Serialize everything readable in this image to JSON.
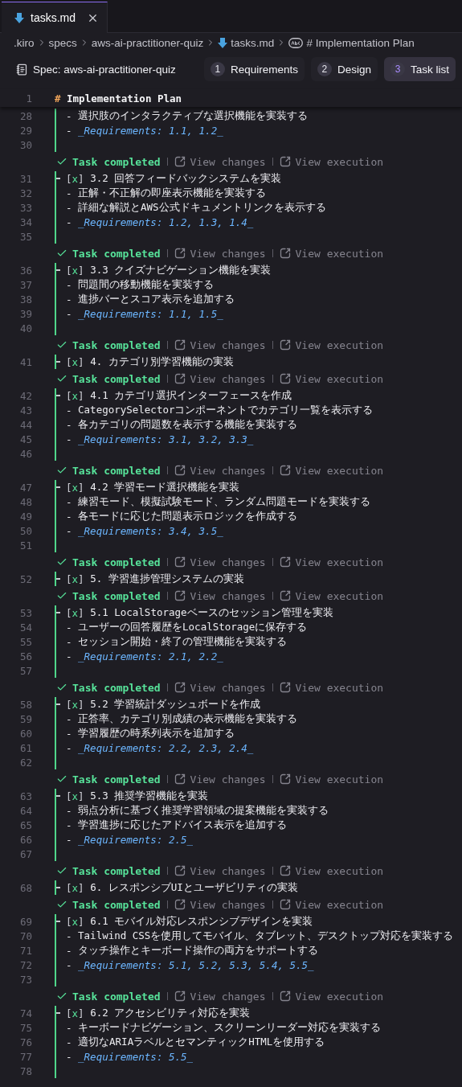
{
  "tab": {
    "label": "tasks.md",
    "selected": true
  },
  "breadcrumb": [
    {
      "label": ".kiro",
      "kind": "folder"
    },
    {
      "label": "specs",
      "kind": "folder"
    },
    {
      "label": "aws-ai-practitioner-quiz",
      "kind": "folder"
    },
    {
      "label": "tasks.md",
      "kind": "file"
    },
    {
      "label": "# Implementation Plan",
      "kind": "symbol"
    }
  ],
  "spec": {
    "title": "Spec: aws-ai-practitioner-quiz",
    "steps": [
      {
        "num": "1",
        "label": "Requirements",
        "selected": false
      },
      {
        "num": "2",
        "label": "Design",
        "selected": false
      },
      {
        "num": "3",
        "label": "Task list",
        "selected": true
      }
    ]
  },
  "sticky": {
    "n": "1",
    "hash": "#",
    "text": "Implementation Plan"
  },
  "groups": [
    {
      "lines": [
        {
          "n": "28",
          "kind": "bullet",
          "bullet": "-",
          "text": "選択肢のインタラクティブな選択機能を実装する"
        },
        {
          "n": "29",
          "kind": "requirement",
          "bullet": "-",
          "text": "_Requirements: 1.1, 1.2_"
        },
        {
          "n": "30",
          "kind": "blank"
        }
      ]
    },
    {
      "lens": {
        "status": "Task completed",
        "actions": [
          "View changes",
          "View execution"
        ]
      },
      "lines": [
        {
          "n": "31",
          "kind": "task",
          "box": "[x]",
          "checked": true,
          "text": "3.2 回答フィードバックシステムを実装"
        },
        {
          "n": "32",
          "kind": "bullet",
          "bullet": "-",
          "text": "正解・不正解の即座表示機能を実装する"
        },
        {
          "n": "33",
          "kind": "bullet",
          "bullet": "-",
          "text": "詳細な解説とAWS公式ドキュメントリンクを表示する"
        },
        {
          "n": "34",
          "kind": "requirement",
          "bullet": "-",
          "text": "_Requirements: 1.2, 1.3, 1.4_"
        },
        {
          "n": "35",
          "kind": "blank"
        }
      ]
    },
    {
      "lens": {
        "status": "Task completed",
        "actions": [
          "View changes",
          "View execution"
        ]
      },
      "lines": [
        {
          "n": "36",
          "kind": "task",
          "box": "[x]",
          "checked": true,
          "text": "3.3 クイズナビゲーション機能を実装"
        },
        {
          "n": "37",
          "kind": "bullet",
          "bullet": "-",
          "text": "問題間の移動機能を実装する"
        },
        {
          "n": "38",
          "kind": "bullet",
          "bullet": "-",
          "text": "進捗バーとスコア表示を追加する"
        },
        {
          "n": "39",
          "kind": "requirement",
          "bullet": "-",
          "text": "_Requirements: 1.1, 1.5_"
        },
        {
          "n": "40",
          "kind": "blank"
        }
      ]
    },
    {
      "lens": {
        "status": "Task completed",
        "actions": [
          "View changes",
          "View execution"
        ]
      },
      "lines": [
        {
          "n": "41",
          "kind": "task",
          "box": "[x]",
          "checked": true,
          "text": "4. カテゴリ別学習機能の実装"
        }
      ]
    },
    {
      "lens": {
        "status": "Task completed",
        "actions": [
          "View changes",
          "View execution"
        ]
      },
      "lines": [
        {
          "n": "42",
          "kind": "task",
          "box": "[x]",
          "checked": true,
          "text": "4.1 カテゴリ選択インターフェースを作成"
        },
        {
          "n": "43",
          "kind": "bullet",
          "bullet": "-",
          "text": "CategorySelectorコンポーネントでカテゴリ一覧を表示する"
        },
        {
          "n": "44",
          "kind": "bullet",
          "bullet": "-",
          "text": "各カテゴリの問題数を表示する機能を実装する"
        },
        {
          "n": "45",
          "kind": "requirement",
          "bullet": "-",
          "text": "_Requirements: 3.1, 3.2, 3.3_"
        },
        {
          "n": "46",
          "kind": "blank"
        }
      ]
    },
    {
      "lens": {
        "status": "Task completed",
        "actions": [
          "View changes",
          "View execution"
        ]
      },
      "lines": [
        {
          "n": "47",
          "kind": "task",
          "box": "[x]",
          "checked": true,
          "text": "4.2 学習モード選択機能を実装"
        },
        {
          "n": "48",
          "kind": "bullet",
          "bullet": "-",
          "text": "練習モード、模擬試験モード、ランダム問題モードを実装する"
        },
        {
          "n": "49",
          "kind": "bullet",
          "bullet": "-",
          "text": "各モードに応じた問題表示ロジックを作成する"
        },
        {
          "n": "50",
          "kind": "requirement",
          "bullet": "-",
          "text": "_Requirements: 3.4, 3.5_"
        },
        {
          "n": "51",
          "kind": "blank"
        }
      ]
    },
    {
      "lens": {
        "status": "Task completed",
        "actions": [
          "View changes",
          "View execution"
        ]
      },
      "lines": [
        {
          "n": "52",
          "kind": "task",
          "box": "[x]",
          "checked": true,
          "text": "5. 学習進捗管理システムの実装"
        }
      ]
    },
    {
      "lens": {
        "status": "Task completed",
        "actions": [
          "View changes",
          "View execution"
        ]
      },
      "lines": [
        {
          "n": "53",
          "kind": "task",
          "box": "[x]",
          "checked": true,
          "text": "5.1 LocalStorageベースのセッション管理を実装"
        },
        {
          "n": "54",
          "kind": "bullet",
          "bullet": "-",
          "text": "ユーザーの回答履歴をLocalStorageに保存する"
        },
        {
          "n": "55",
          "kind": "bullet",
          "bullet": "-",
          "text": "セッション開始・終了の管理機能を実装する"
        },
        {
          "n": "56",
          "kind": "requirement",
          "bullet": "-",
          "text": "_Requirements: 2.1, 2.2_"
        },
        {
          "n": "57",
          "kind": "blank"
        }
      ]
    },
    {
      "lens": {
        "status": "Task completed",
        "actions": [
          "View changes",
          "View execution"
        ]
      },
      "lines": [
        {
          "n": "58",
          "kind": "task",
          "box": "[x]",
          "checked": true,
          "text": "5.2 学習統計ダッシュボードを作成"
        },
        {
          "n": "59",
          "kind": "bullet",
          "bullet": "-",
          "text": "正答率、カテゴリ別成績の表示機能を実装する"
        },
        {
          "n": "60",
          "kind": "bullet",
          "bullet": "-",
          "text": "学習履歴の時系列表示を追加する"
        },
        {
          "n": "61",
          "kind": "requirement",
          "bullet": "-",
          "text": "_Requirements: 2.2, 2.3, 2.4_"
        },
        {
          "n": "62",
          "kind": "blank"
        }
      ]
    },
    {
      "lens": {
        "status": "Task completed",
        "actions": [
          "View changes",
          "View execution"
        ]
      },
      "lines": [
        {
          "n": "63",
          "kind": "task",
          "box": "[x]",
          "checked": true,
          "text": "5.3 推奨学習機能を実装"
        },
        {
          "n": "64",
          "kind": "bullet",
          "bullet": "-",
          "text": "弱点分析に基づく推奨学習領域の提案機能を実装する"
        },
        {
          "n": "65",
          "kind": "bullet",
          "bullet": "-",
          "text": "学習進捗に応じたアドバイス表示を追加する"
        },
        {
          "n": "66",
          "kind": "requirement",
          "bullet": "-",
          "text": "_Requirements: 2.5_"
        },
        {
          "n": "67",
          "kind": "blank"
        }
      ]
    },
    {
      "lens": {
        "status": "Task completed",
        "actions": [
          "View changes",
          "View execution"
        ]
      },
      "lines": [
        {
          "n": "68",
          "kind": "task",
          "box": "[x]",
          "checked": true,
          "text": "6. レスポンシブUIとユーザビリティの実装"
        }
      ]
    },
    {
      "lens": {
        "status": "Task completed",
        "actions": [
          "View changes",
          "View execution"
        ]
      },
      "lines": [
        {
          "n": "69",
          "kind": "task",
          "box": "[x]",
          "checked": true,
          "text": "6.1 モバイル対応レスポンシブデザインを実装"
        },
        {
          "n": "70",
          "kind": "bullet",
          "bullet": "-",
          "text": "Tailwind CSSを使用してモバイル、タブレット、デスクトップ対応を実装する"
        },
        {
          "n": "71",
          "kind": "bullet",
          "bullet": "-",
          "text": "タッチ操作とキーボード操作の両方をサポートする"
        },
        {
          "n": "72",
          "kind": "requirement",
          "bullet": "-",
          "text": "_Requirements: 5.1, 5.2, 5.3, 5.4, 5.5_"
        },
        {
          "n": "73",
          "kind": "blank"
        }
      ]
    },
    {
      "lens": {
        "status": "Task completed",
        "actions": [
          "View changes",
          "View execution"
        ]
      },
      "lines": [
        {
          "n": "74",
          "kind": "task",
          "box": "[x]",
          "checked": true,
          "text": "6.2 アクセシビリティ対応を実装"
        },
        {
          "n": "75",
          "kind": "bullet",
          "bullet": "-",
          "text": "キーボードナビゲーション、スクリーンリーダー対応を実装する"
        },
        {
          "n": "76",
          "kind": "bullet",
          "bullet": "-",
          "text": "適切なARIAラベルとセマンティックHTMLを使用する"
        },
        {
          "n": "77",
          "kind": "requirement",
          "bullet": "-",
          "text": "_Requirements: 5.5_"
        },
        {
          "n": "78",
          "kind": "blank"
        }
      ]
    }
  ]
}
